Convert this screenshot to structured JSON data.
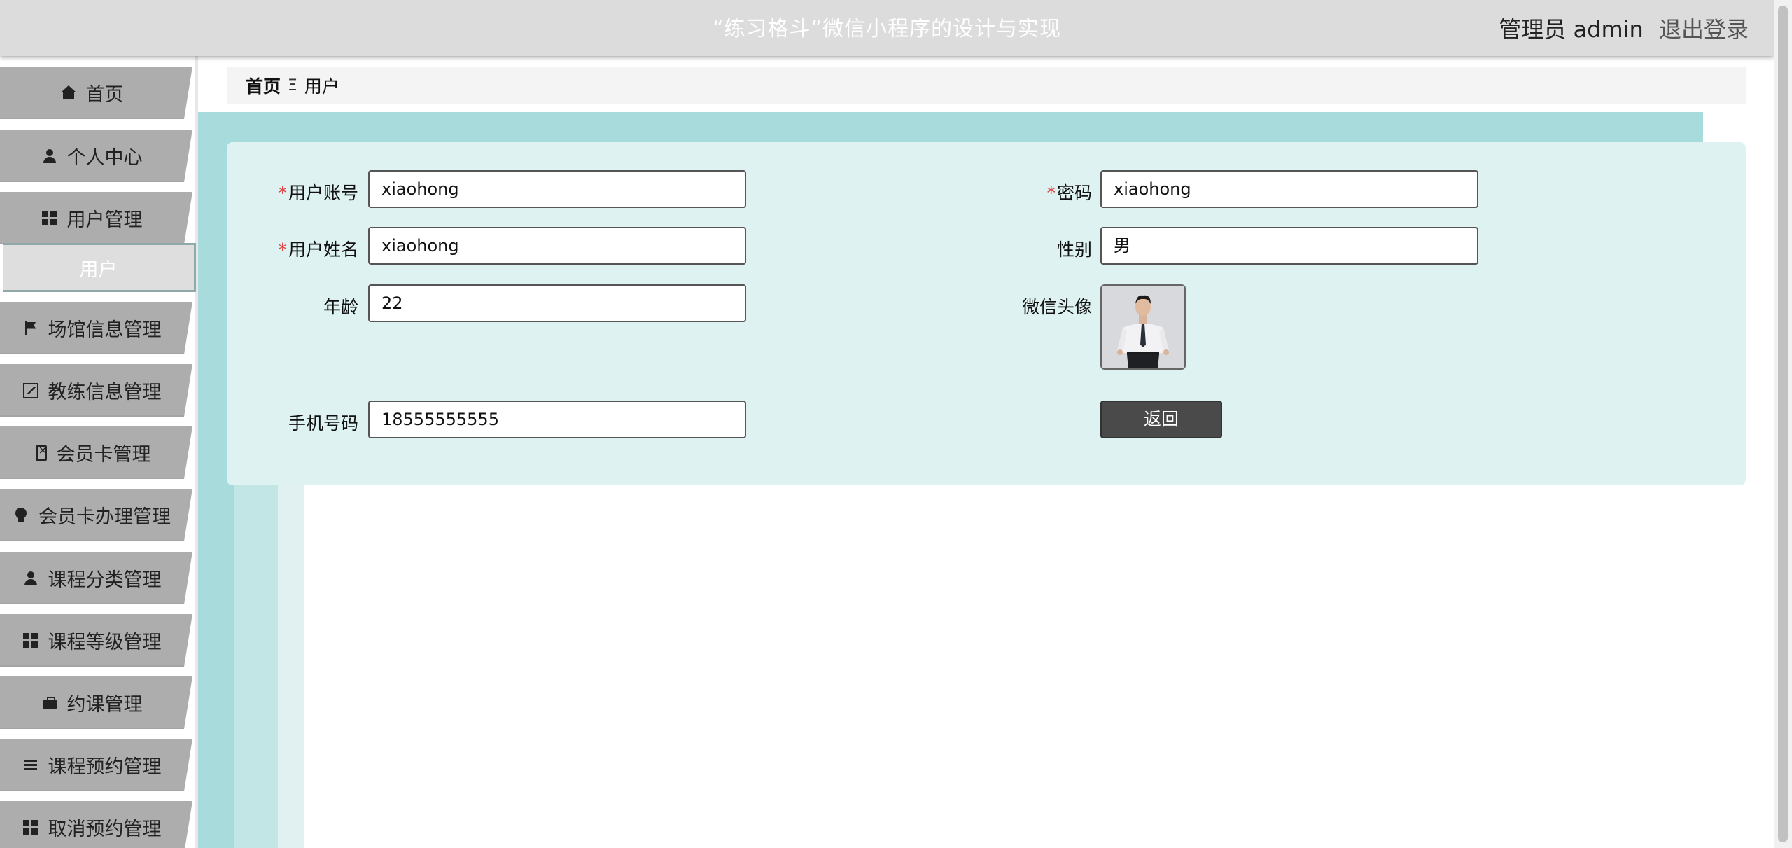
{
  "header": {
    "title": "“练习格斗”微信小程序的设计与实现",
    "role": "管理员 admin",
    "logout": "退出登录"
  },
  "sidebar": {
    "items": [
      {
        "label": "首页",
        "icon": "home-icon"
      },
      {
        "label": "个人中心",
        "icon": "person-icon"
      },
      {
        "label": "用户管理",
        "icon": "grid-icon"
      },
      {
        "label": "场馆信息管理",
        "icon": "flag-icon"
      },
      {
        "label": "教练信息管理",
        "icon": "chart-icon"
      },
      {
        "label": "会员卡管理",
        "icon": "clipboard-icon"
      },
      {
        "label": "会员卡办理管理",
        "icon": "bulb-icon"
      },
      {
        "label": "课程分类管理",
        "icon": "person-icon"
      },
      {
        "label": "课程等级管理",
        "icon": "grid-icon"
      },
      {
        "label": "约课管理",
        "icon": "briefcase-icon"
      },
      {
        "label": "课程预约管理",
        "icon": "list-icon"
      },
      {
        "label": "取消预约管理",
        "icon": "grid-icon"
      }
    ],
    "sub_item": {
      "label": "用户"
    }
  },
  "breadcrumb": {
    "home": "首页",
    "separator": "Ξ",
    "current": "用户"
  },
  "form": {
    "account": {
      "label": "用户账号",
      "value": "xiaohong",
      "required": true
    },
    "password": {
      "label": "密码",
      "value": "xiaohong",
      "required": true
    },
    "name": {
      "label": "用户姓名",
      "value": "xiaohong",
      "required": true
    },
    "gender": {
      "label": "性别",
      "value": "男"
    },
    "age": {
      "label": "年龄",
      "value": "22"
    },
    "avatar": {
      "label": "微信头像"
    },
    "phone": {
      "label": "手机号码",
      "value": "18555555555"
    },
    "back_button": "返回"
  },
  "colors": {
    "header_bg": "#dcdcdc",
    "sidebar_item_bg": "#adadad",
    "content_bg": "#a8dcdc",
    "form_bg": "#dff2f2",
    "required": "#e04040",
    "button_bg": "#4a4a4a"
  }
}
